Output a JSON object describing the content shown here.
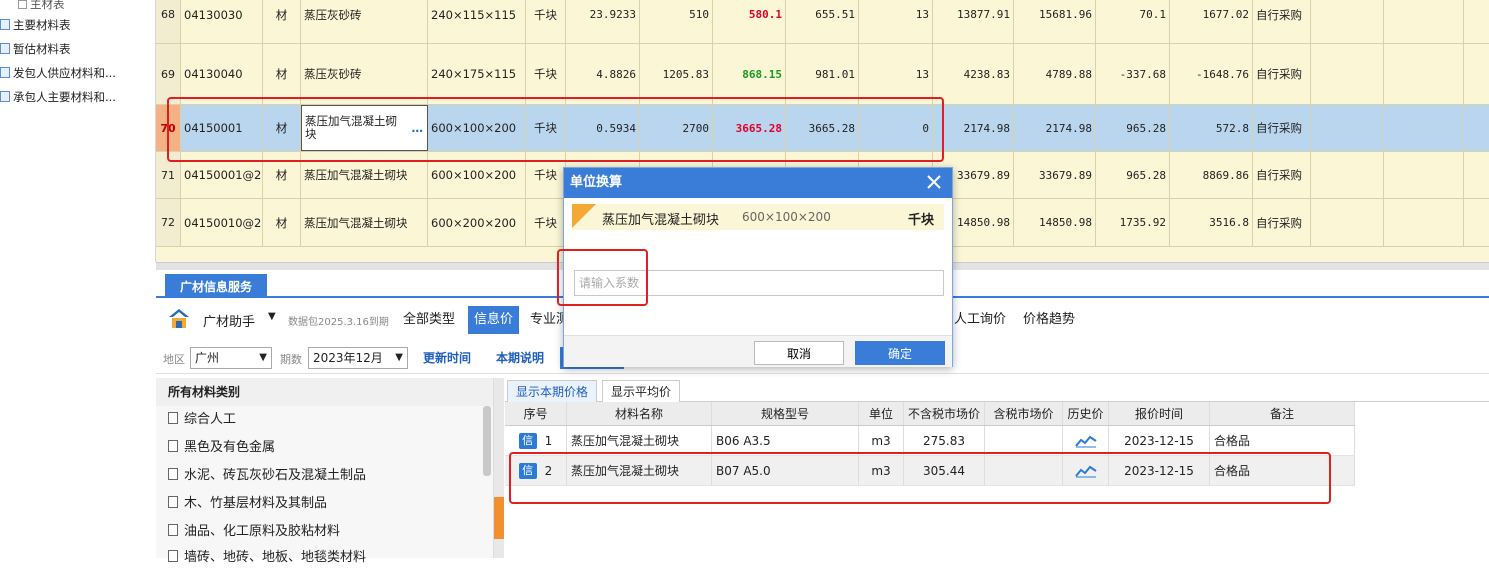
{
  "left_tree": {
    "items": [
      {
        "label": "主材表",
        "sub": true
      },
      {
        "label": "主要材料表",
        "sub": false
      },
      {
        "label": "暂估材料表",
        "sub": false
      },
      {
        "label": "发包人供应材料和...",
        "sub": false
      },
      {
        "label": "承包人主要材料和...",
        "sub": false
      }
    ]
  },
  "top_table": {
    "rows": [
      {
        "no": "68",
        "code": "04130030",
        "type": "材",
        "name": "蒸压灰砂砖",
        "spec": "240×115×115",
        "unit": "千块",
        "qty": "23.9233",
        "price1": "510",
        "market": "580.1",
        "market_color": "red",
        "tax_price": "655.51",
        "rate": "13",
        "amt1": "13877.91",
        "amt2": "15681.96",
        "diff1": "70.1",
        "diff2": "1677.02",
        "source": "自行采购"
      },
      {
        "no": "69",
        "code": "04130040",
        "type": "材",
        "name": "蒸压灰砂砖",
        "spec": "240×175×115",
        "unit": "千块",
        "qty": "4.8826",
        "price1": "1205.83",
        "market": "868.15",
        "market_color": "green",
        "tax_price": "981.01",
        "rate": "13",
        "amt1": "4238.83",
        "amt2": "4789.88",
        "diff1": "-337.68",
        "diff2": "-1648.76",
        "source": "自行采购"
      },
      {
        "no": "70",
        "code": "04150001",
        "type": "材",
        "name": "蒸压加气混凝土砌块",
        "spec": "600×100×200",
        "unit": "千块",
        "qty": "0.5934",
        "price1": "2700",
        "market": "3665.28",
        "market_color": "red",
        "tax_price": "3665.28",
        "rate": "0",
        "amt1": "2174.98",
        "amt2": "2174.98",
        "diff1": "965.28",
        "diff2": "572.8",
        "source": "自行采购"
      },
      {
        "no": "71",
        "code": "04150001@2",
        "type": "材",
        "name": "蒸压加气混凝土砌块",
        "spec": "600×100×200",
        "unit": "千块",
        "qty": "",
        "price1": "",
        "market": "",
        "market_color": "",
        "tax_price": "",
        "rate": "",
        "amt1": "33679.89",
        "amt2": "33679.89",
        "diff1": "965.28",
        "diff2": "8869.86",
        "source": "自行采购"
      },
      {
        "no": "72",
        "code": "04150010@2",
        "type": "材",
        "name": "蒸压加气混凝土砌块",
        "spec": "600×200×200",
        "unit": "千块",
        "qty": "",
        "price1": "",
        "market": "",
        "market_color": "",
        "tax_price": "",
        "rate": "",
        "amt1": "14850.98",
        "amt2": "14850.98",
        "diff1": "1735.92",
        "diff2": "3516.8",
        "source": "自行采购"
      }
    ]
  },
  "info_panel": {
    "tab": "广材信息服务",
    "assistant": {
      "title": "广材助手",
      "package": "数据包2025.3.16到期",
      "tabs": [
        "全部类型",
        "信息价",
        "专业测",
        "人工询价",
        "价格趋势"
      ],
      "active_tab": "信息价"
    },
    "filters": {
      "region_label": "地区",
      "region": "广州",
      "period_label": "期数",
      "period": "2023年12月",
      "update_btn": "更新时间",
      "note_btn": "本期说明"
    },
    "categories": {
      "header": "所有材料类别",
      "items": [
        "综合人工",
        "黑色及有色金属",
        "水泥、砖瓦灰砂石及混凝土制品",
        "木、竹基层材料及其制品",
        "油品、化工原料及胶粘材料",
        "墙砖、地砖、地板、地毯类材料"
      ]
    },
    "price_tabs": [
      "显示本期价格",
      "显示平均价"
    ],
    "price_table": {
      "headers": [
        "序号",
        "材料名称",
        "规格型号",
        "单位",
        "不含税市场价",
        "含税市场价",
        "历史价",
        "报价时间",
        "备注"
      ],
      "rows": [
        {
          "badge": "信",
          "no": "1",
          "name": "蒸压加气混凝土砌块",
          "spec": "B06 A3.5",
          "unit": "m3",
          "price_ex": "275.83",
          "price_in": "",
          "date": "2023-12-15",
          "note": "合格品"
        },
        {
          "badge": "信",
          "no": "2",
          "name": "蒸压加气混凝土砌块",
          "spec": "B07 A5.0",
          "unit": "m3",
          "price_ex": "305.44",
          "price_in": "",
          "date": "2023-12-15",
          "note": "合格品"
        }
      ]
    }
  },
  "dialog": {
    "title": "单位换算",
    "material_name": "蒸压加气混凝土砌块",
    "material_spec": "600×100×200",
    "material_unit": "千块",
    "input_placeholder": "请输入系数",
    "input_value": "",
    "cancel": "取消",
    "ok": "确定"
  },
  "colors": {
    "accent": "#3a7dd8",
    "row_bg": "#fbf6d6",
    "selected_row": "#b9d6ee",
    "annotation": "#e02020",
    "up_price": "#e0002a",
    "down_price": "#1a9b1a"
  }
}
